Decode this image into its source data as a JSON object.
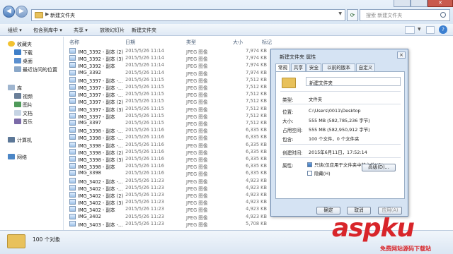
{
  "window": {
    "address": "新建文件夹",
    "search_placeholder": "搜索 新建文件夹"
  },
  "toolbar": {
    "organize": "组织 ▾",
    "include_in_library": "包含到库中 ▾",
    "share": "共享 ▾",
    "slideshow": "放映幻灯片",
    "new_folder": "新建文件夹"
  },
  "sidebar": {
    "favorites": "收藏夹",
    "downloads": "下载",
    "desktop": "桌面",
    "recent": "最近访问的位置",
    "libraries": "库",
    "videos": "视频",
    "pictures": "图片",
    "documents": "文档",
    "music": "音乐",
    "computer": "计算机",
    "network": "网络"
  },
  "columns": {
    "name": "名称",
    "date": "日期",
    "type": "类型",
    "size": "大小",
    "tags": "标记"
  },
  "files": [
    {
      "name": "IMG_3392 - 副本 (2)",
      "date": "2015/5/26 11:14",
      "type": "JPEG 图像",
      "size": "7,974 KB"
    },
    {
      "name": "IMG_3392 - 副本 (3)",
      "date": "2015/5/26 11:14",
      "type": "JPEG 图像",
      "size": "7,974 KB"
    },
    {
      "name": "IMG_3392 - 副本",
      "date": "2015/5/26 11:14",
      "type": "JPEG 图像",
      "size": "7,974 KB"
    },
    {
      "name": "IMG_3392",
      "date": "2015/5/26 11:14",
      "type": "JPEG 图像",
      "size": "7,974 KB"
    },
    {
      "name": "IMG_3397 - 副本 -...",
      "date": "2015/5/26 11:15",
      "type": "JPEG 图像",
      "size": "7,512 KB"
    },
    {
      "name": "IMG_3397 - 副本 -...",
      "date": "2015/5/26 11:15",
      "type": "JPEG 图像",
      "size": "7,512 KB"
    },
    {
      "name": "IMG_3397 - 副本 -...",
      "date": "2015/5/26 11:15",
      "type": "JPEG 图像",
      "size": "7,512 KB"
    },
    {
      "name": "IMG_3397 - 副本 (2)",
      "date": "2015/5/26 11:15",
      "type": "JPEG 图像",
      "size": "7,512 KB"
    },
    {
      "name": "IMG_3397 - 副本 (3)",
      "date": "2015/5/26 11:15",
      "type": "JPEG 图像",
      "size": "7,512 KB"
    },
    {
      "name": "IMG_3397 - 副本",
      "date": "2015/5/26 11:15",
      "type": "JPEG 图像",
      "size": "7,512 KB"
    },
    {
      "name": "IMG_3397",
      "date": "2015/5/26 11:15",
      "type": "JPEG 图像",
      "size": "7,512 KB"
    },
    {
      "name": "IMG_3398 - 副本 -...",
      "date": "2015/5/26 11:16",
      "type": "JPEG 图像",
      "size": "6,335 KB"
    },
    {
      "name": "IMG_3398 - 副本 -...",
      "date": "2015/5/26 11:16",
      "type": "JPEG 图像",
      "size": "6,335 KB"
    },
    {
      "name": "IMG_3398 - 副本 -...",
      "date": "2015/5/26 11:16",
      "type": "JPEG 图像",
      "size": "6,335 KB"
    },
    {
      "name": "IMG_3398 - 副本 (2)",
      "date": "2015/5/26 11:16",
      "type": "JPEG 图像",
      "size": "6,335 KB"
    },
    {
      "name": "IMG_3398 - 副本 (3)",
      "date": "2015/5/26 11:16",
      "type": "JPEG 图像",
      "size": "6,335 KB"
    },
    {
      "name": "IMG_3398 - 副本",
      "date": "2015/5/26 11:16",
      "type": "JPEG 图像",
      "size": "6,335 KB"
    },
    {
      "name": "IMG_3398",
      "date": "2015/5/26 11:16",
      "type": "JPEG 图像",
      "size": "6,335 KB"
    },
    {
      "name": "IMG_3402 - 副本 -...",
      "date": "2015/5/26 11:23",
      "type": "JPEG 图像",
      "size": "4,923 KB"
    },
    {
      "name": "IMG_3402 - 副本 -...",
      "date": "2015/5/26 11:23",
      "type": "JPEG 图像",
      "size": "4,923 KB"
    },
    {
      "name": "IMG_3402 - 副本 (2)",
      "date": "2015/5/26 11:23",
      "type": "JPEG 图像",
      "size": "4,923 KB"
    },
    {
      "name": "IMG_3402 - 副本 (3)",
      "date": "2015/5/26 11:23",
      "type": "JPEG 图像",
      "size": "4,923 KB"
    },
    {
      "name": "IMG_3402 - 副本",
      "date": "2015/5/26 11:23",
      "type": "JPEG 图像",
      "size": "4,923 KB"
    },
    {
      "name": "IMG_3402",
      "date": "2015/5/26 11:23",
      "type": "JPEG 图像",
      "size": "4,923 KB"
    },
    {
      "name": "IMG_3403 - 副本 -...",
      "date": "2015/5/26 11:23",
      "type": "JPEG 图像",
      "size": "5,708 KB"
    }
  ],
  "status": {
    "count": "100 个对象"
  },
  "dialog": {
    "title": "新建文件夹 属性",
    "close": "×",
    "tabs": [
      "常规",
      "共享",
      "安全",
      "以前的版本",
      "自定义"
    ],
    "folder_name": "新建文件夹",
    "type_label": "类型:",
    "type_value": "文件夹",
    "location_label": "位置:",
    "location_value": "C:\\Users\\0011\\Desktop",
    "size_label": "大小:",
    "size_value": "555 MB (582,785,236 字节)",
    "disk_size_label": "占用空间:",
    "disk_size_value": "555 MB (582,950,912 字节)",
    "contains_label": "包含:",
    "contains_value": "100 个文件，0 个文件夹",
    "created_label": "创建时间:",
    "created_value": "2015年6月11日，17:52:14",
    "attributes_label": "属性:",
    "readonly_label": "只读(仅应用于文件夹中的文件)(R)",
    "hidden_label": "隐藏(H)",
    "advanced_button": "高级(D)...",
    "ok": "确定",
    "cancel": "取消",
    "apply": "应用(A)"
  },
  "watermark": {
    "text": "aspku",
    "sub": "免费网站源码下载站"
  }
}
